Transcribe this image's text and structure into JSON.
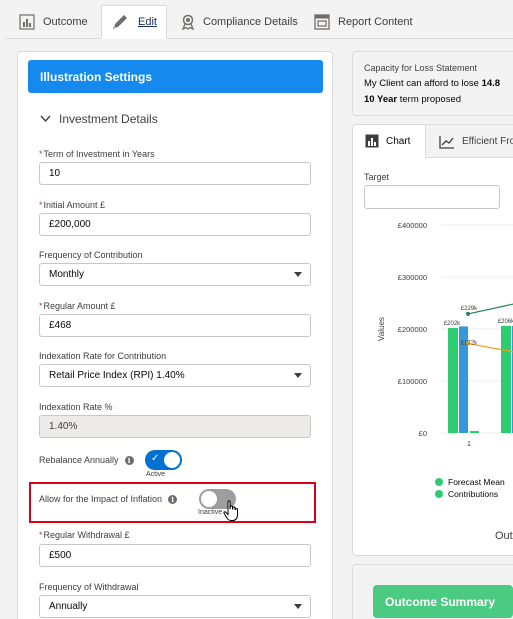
{
  "tabs": [
    {
      "label": "Outcome",
      "icon": "bar-chart-icon"
    },
    {
      "label": "Edit",
      "icon": "pencil-icon"
    },
    {
      "label": "Compliance Details",
      "icon": "award-icon"
    },
    {
      "label": "Report Content",
      "icon": "report-icon"
    }
  ],
  "settings": {
    "header": "Illustration Settings",
    "section_title": "Investment Details",
    "term": {
      "label": "Term of Investment in Years",
      "value": "10"
    },
    "initial_amount": {
      "label": "Initial Amount £",
      "value": "£200,000"
    },
    "frequency_contribution": {
      "label": "Frequency of Contribution",
      "value": "Monthly"
    },
    "regular_amount": {
      "label": "Regular Amount £",
      "value": "£468"
    },
    "indexation_rate_contribution": {
      "label": "Indexation Rate for Contribution",
      "value": "Retail Price Index (RPI) 1.40%"
    },
    "indexation_rate": {
      "label": "Indexation Rate %",
      "value": "1.40%"
    },
    "rebalance": {
      "label": "Rebalance Annually",
      "state": "Active"
    },
    "inflation": {
      "label": "Allow for the Impact of Inflation",
      "state": "Inactive"
    },
    "regular_withdrawal": {
      "label": "Regular Withdrawal £",
      "value": "£500"
    },
    "frequency_withdrawal": {
      "label": "Frequency of Withdrawal",
      "value": "Annually"
    }
  },
  "capacity": {
    "title": "Capacity for Loss Statement",
    "line1_prefix": "My Client can afford to lose ",
    "line1_bold": "14.8",
    "line2_bold": "10 Year",
    "line2_suffix": " term proposed"
  },
  "chart_tabs": [
    {
      "label": "Chart",
      "icon": "bar-chart-icon"
    },
    {
      "label": "Efficient Fro",
      "icon": "line-chart-icon"
    }
  ],
  "target": {
    "label": "Target",
    "value": ""
  },
  "chart_data": {
    "type": "bar",
    "ylabel": "Values",
    "ylim": [
      0,
      400000
    ],
    "yticks": [
      "£400000",
      "£300000",
      "£200000",
      "£100000",
      "£0"
    ],
    "categories": [
      "1"
    ],
    "series": [
      {
        "name": "Forecast Mean",
        "color": "#2ecc71",
        "values": [
          202000
        ]
      },
      {
        "name": "Contributions",
        "color": "#3498db",
        "values": [
          205000
        ]
      }
    ],
    "data_labels": [
      "£202k",
      "£229k",
      "£172k",
      "£206k"
    ],
    "legend": [
      "Forecast Mean",
      "Contributions"
    ],
    "outcome_label": "Out"
  },
  "outcome_summary_label": "Outcome Summary",
  "colors": {
    "accent": "#1589ee",
    "success": "#4bca81",
    "highlight": "#d9001b"
  }
}
